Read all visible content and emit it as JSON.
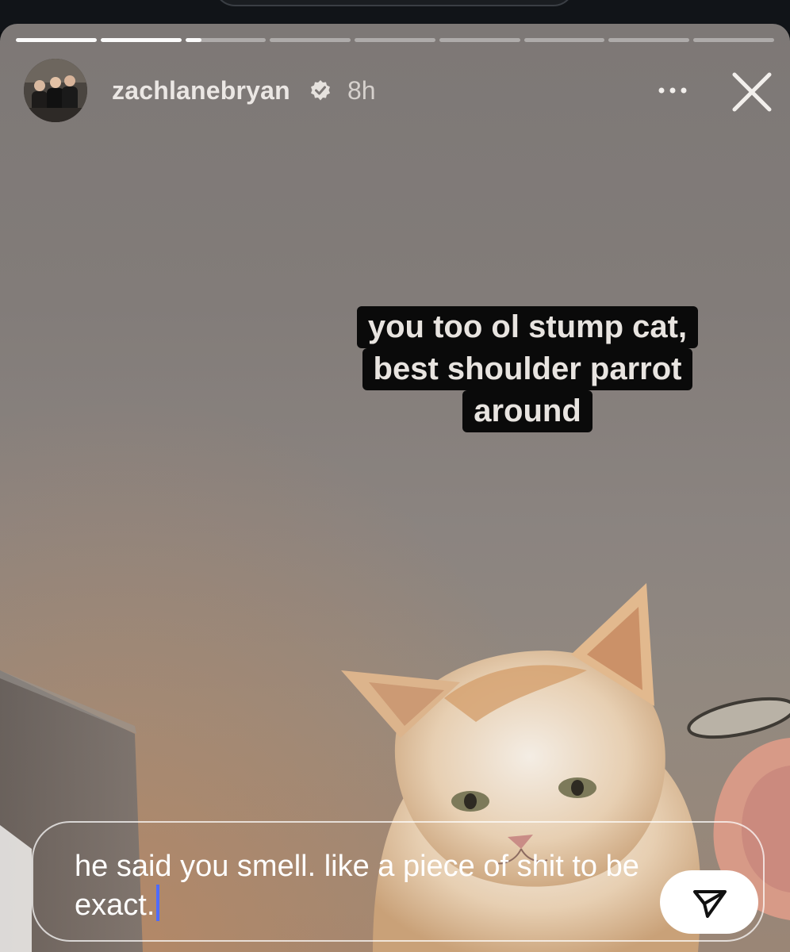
{
  "story": {
    "progress": [
      1,
      1,
      0.2,
      0,
      0,
      0,
      0,
      0,
      0
    ],
    "username": "zachlanebryan",
    "time": "8h",
    "caption_lines": [
      "you too ol stump cat,",
      "best shoulder parrot",
      "around"
    ]
  },
  "reply": {
    "text": "he said you smell. like a piece of shit to be exact."
  },
  "icons": {
    "verified": "verified-badge-icon",
    "more": "more-options-icon",
    "close": "close-icon",
    "send": "send-icon"
  }
}
